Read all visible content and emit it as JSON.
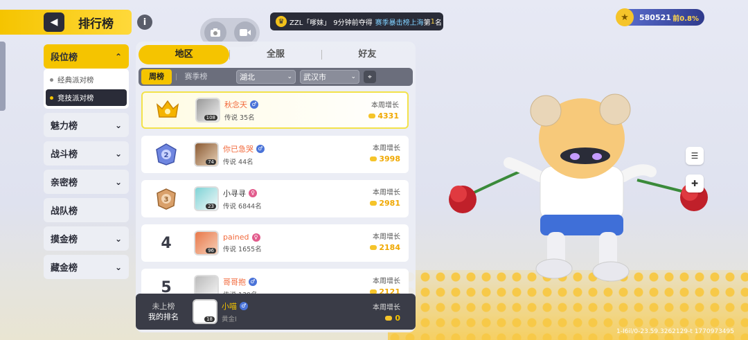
{
  "header": {
    "title": "排行榜"
  },
  "notice": {
    "user": "ZZL「嗲妹」",
    "time": "9分钟前夺得",
    "board": "赛季暴击榜上海",
    "rank_prefix": "第",
    "rank": "1",
    "rank_suffix": "名"
  },
  "currency": {
    "value": "580521",
    "rank": "前0.8%"
  },
  "categories": [
    {
      "label": "段位榜",
      "expanded": true,
      "sub": [
        {
          "label": "经典派对榜"
        },
        {
          "label": "竞技派对榜",
          "active": true
        }
      ]
    },
    {
      "label": "魅力榜"
    },
    {
      "label": "战斗榜"
    },
    {
      "label": "亲密榜"
    },
    {
      "label": "战队榜"
    },
    {
      "label": "摸金榜"
    },
    {
      "label": "藏金榜"
    }
  ],
  "tabs": [
    {
      "label": "地区",
      "active": true
    },
    {
      "label": "全服"
    },
    {
      "label": "好友"
    }
  ],
  "filters": {
    "week": "周榜",
    "season": "赛季榜",
    "province": "湖北",
    "city": "武汉市"
  },
  "rows": [
    {
      "rank": "1",
      "name": "秋念天",
      "gender": "m",
      "level": "108",
      "tier": "传说 35名",
      "growth_label": "本周增长",
      "growth": "4331"
    },
    {
      "rank": "2",
      "name": "你已急哭",
      "gender": "m",
      "level": "74",
      "tier": "传说 44名",
      "growth_label": "本周增长",
      "growth": "3998"
    },
    {
      "rank": "3",
      "name": "小寻寻",
      "gender": "f",
      "level": "23",
      "tier": "传说 6844名",
      "growth_label": "本周增长",
      "growth": "2981"
    },
    {
      "rank": "4",
      "name": "pained",
      "gender": "f",
      "level": "96",
      "tier": "传说 1655名",
      "growth_label": "本周增长",
      "growth": "2184"
    },
    {
      "rank": "5",
      "name": "哥哥抱",
      "gender": "m",
      "level": "",
      "tier": "传说 139名",
      "growth_label": "本周增长",
      "growth": "2121"
    }
  ],
  "my_rank": {
    "status": "未上榜",
    "label": "我的排名",
    "name": "小喵",
    "gender": "m",
    "level": "18",
    "tier": "黄金I",
    "growth_label": "本周增长",
    "growth": "0"
  },
  "footer": {
    "uid": "1-I6il/0-23.59.3262129-t 1770973495"
  },
  "colors": {
    "accent": "#f5c400",
    "dark": "#2a2c38",
    "orange_name": "#f26a3c"
  }
}
